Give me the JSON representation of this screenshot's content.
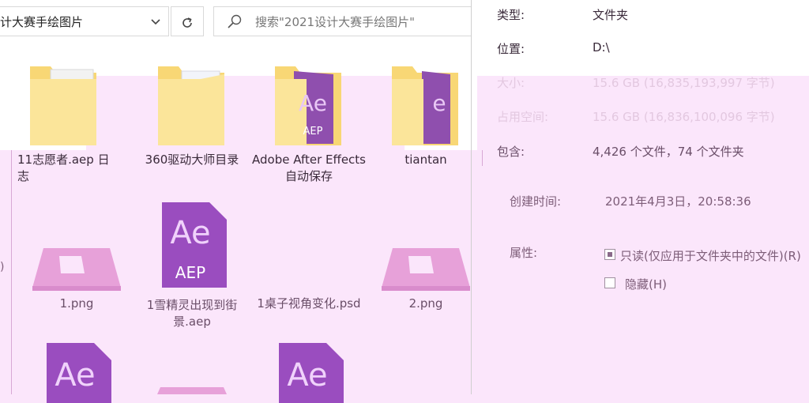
{
  "address_bar": {
    "path_text": "计大赛手绘图片",
    "dropdown_icon": "chevron-down-icon"
  },
  "refresh_icon": "refresh-icon",
  "search": {
    "placeholder": "搜索\"2021设计大赛手绘图片\""
  },
  "properties": {
    "type_label": "类型:",
    "type_value": "文件夹",
    "location_label": "位置:",
    "location_value": "D:\\",
    "size_label": "大小:",
    "size_value": "15.6 GB (16,835,193,997 字节)",
    "disk_label": "占用空间:",
    "disk_value": "15.6 GB (16,836,100,096 字节)",
    "contains_label": "包含:",
    "contains_value": "4,426 个文件，74 个文件夹",
    "created_label": "创建时间:",
    "created_value": "2021年4月3日，20:58:36",
    "attributes_label": "属性:",
    "readonly_label": "只读(仅应用于文件夹中的文件)(R)",
    "hidden_label": "隐藏(H)"
  },
  "files": {
    "f1": "11志愿者.aep 日志",
    "f2": "360驱动大师目录",
    "f3": "Adobe After Effects 自动保存",
    "f4": "tiantan",
    "f5": "1.png",
    "f6": "1雪精灵出现到街景.aep",
    "f7": "1桌子视角变化.psd",
    "f8": "2.png",
    "ae_label": "Ae",
    "aep_label": "AEP"
  },
  "left_edge_char": ")"
}
